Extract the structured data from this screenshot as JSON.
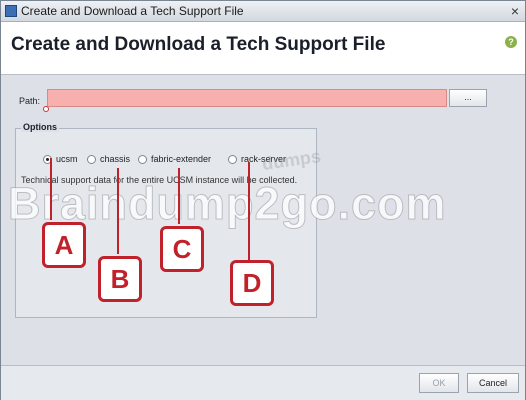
{
  "window": {
    "title": "Create and Download a Tech Support File",
    "close_glyph": "×"
  },
  "header": {
    "title": "Create and Download a Tech Support File",
    "help_glyph": "?"
  },
  "path": {
    "label": "Path:",
    "value": "",
    "browse_label": "..."
  },
  "options": {
    "legend": "Options",
    "radios": [
      {
        "label": "ucsm",
        "checked": true
      },
      {
        "label": "chassis",
        "checked": false
      },
      {
        "label": "fabric-extender",
        "checked": false
      },
      {
        "label": "rack-server",
        "checked": false
      }
    ],
    "description": "Technical support data for the entire UCSM instance will be collected."
  },
  "footer": {
    "ok_label": "OK",
    "cancel_label": "Cancel"
  },
  "overlay": {
    "watermark_small": "dumps",
    "watermark_large": "Braindump2go.com",
    "callouts": [
      "A",
      "B",
      "C",
      "D"
    ],
    "callout_color": "#c0212a"
  }
}
